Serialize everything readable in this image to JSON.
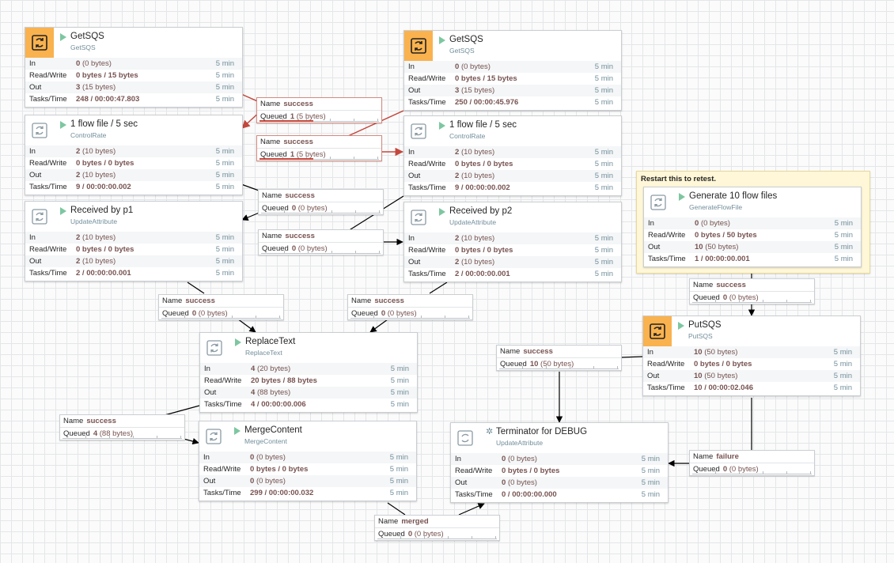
{
  "colors": {
    "active_connection": "#c4473c",
    "connection": "#000000",
    "aws_icon_bg": "#f9b24e",
    "running": "#7dc7a0"
  },
  "labels": {
    "in": "In",
    "rw": "Read/Write",
    "out": "Out",
    "tasks": "Tasks/Time",
    "name": "Name",
    "queued": "Queued",
    "window": "5 min"
  },
  "note": {
    "text": "Restart this to retest."
  },
  "processors": {
    "getsqs1": {
      "icon": "aws-sqs-icon",
      "title": "GetSQS",
      "type": "GetSQS",
      "running": true,
      "in_v": "0",
      "in_s": "(0 bytes)",
      "rw": "0 bytes / 15 bytes",
      "out_v": "3",
      "out_s": "(15 bytes)",
      "tasks": "248 / 00:00:47.803"
    },
    "getsqs2": {
      "icon": "aws-sqs-icon",
      "title": "GetSQS",
      "type": "GetSQS",
      "running": true,
      "in_v": "0",
      "in_s": "(0 bytes)",
      "rw": "0 bytes / 15 bytes",
      "out_v": "3",
      "out_s": "(15 bytes)",
      "tasks": "250 / 00:00:45.976"
    },
    "rate1": {
      "icon": "processor-icon",
      "title": "1 flow file / 5 sec",
      "type": "ControlRate",
      "running": true,
      "in_v": "2",
      "in_s": "(10 bytes)",
      "rw": "0 bytes / 0 bytes",
      "out_v": "2",
      "out_s": "(10 bytes)",
      "tasks": "9 / 00:00:00.002"
    },
    "rate2": {
      "icon": "processor-icon",
      "title": "1 flow file / 5 sec",
      "type": "ControlRate",
      "running": true,
      "in_v": "2",
      "in_s": "(10 bytes)",
      "rw": "0 bytes / 0 bytes",
      "out_v": "2",
      "out_s": "(10 bytes)",
      "tasks": "9 / 00:00:00.002"
    },
    "recv1": {
      "icon": "processor-icon",
      "title": "Received by p1",
      "type": "UpdateAttribute",
      "running": true,
      "in_v": "2",
      "in_s": "(10 bytes)",
      "rw": "0 bytes / 0 bytes",
      "out_v": "2",
      "out_s": "(10 bytes)",
      "tasks": "2 / 00:00:00.001"
    },
    "recv2": {
      "icon": "processor-icon",
      "title": "Received by p2",
      "type": "UpdateAttribute",
      "running": true,
      "in_v": "2",
      "in_s": "(10 bytes)",
      "rw": "0 bytes / 0 bytes",
      "out_v": "2",
      "out_s": "(10 bytes)",
      "tasks": "2 / 00:00:00.001"
    },
    "generate": {
      "icon": "processor-icon",
      "title": "Generate 10 flow files",
      "type": "GenerateFlowFile",
      "running": true,
      "in_v": "0",
      "in_s": "(0 bytes)",
      "rw": "0 bytes / 50 bytes",
      "out_v": "10",
      "out_s": "(50 bytes)",
      "tasks": "1 / 00:00:00.001"
    },
    "putsqs": {
      "icon": "aws-sqs-icon",
      "title": "PutSQS",
      "type": "PutSQS",
      "running": true,
      "in_v": "10",
      "in_s": "(50 bytes)",
      "rw": "0 bytes / 0 bytes",
      "out_v": "10",
      "out_s": "(50 bytes)",
      "tasks": "10 / 00:00:02.046"
    },
    "replace": {
      "icon": "processor-icon",
      "title": "ReplaceText",
      "type": "ReplaceText",
      "running": true,
      "in_v": "4",
      "in_s": "(20 bytes)",
      "rw": "20 bytes / 88 bytes",
      "out_v": "4",
      "out_s": "(88 bytes)",
      "tasks": "4 / 00:00:00.006"
    },
    "merge": {
      "icon": "processor-icon",
      "title": "MergeContent",
      "type": "MergeContent",
      "running": true,
      "in_v": "0",
      "in_s": "(0 bytes)",
      "rw": "0 bytes / 0 bytes",
      "out_v": "0",
      "out_s": "(0 bytes)",
      "tasks": "299 / 00:00:00.032"
    },
    "terminator": {
      "icon": "running-person-icon",
      "title": "Terminator for DEBUG",
      "type": "UpdateAttribute",
      "running": false,
      "in_v": "0",
      "in_s": "(0 bytes)",
      "rw": "0 bytes / 0 bytes",
      "out_v": "0",
      "out_s": "(0 bytes)",
      "tasks": "0 / 00:00:00.000"
    }
  },
  "connections": {
    "c1": {
      "name": "success",
      "queued_v": "1",
      "queued_s": "(5 bytes)",
      "active": true
    },
    "c2": {
      "name": "success",
      "queued_v": "1",
      "queued_s": "(5 bytes)",
      "active": true
    },
    "c3": {
      "name": "success",
      "queued_v": "0",
      "queued_s": "(0 bytes)",
      "active": false
    },
    "c4": {
      "name": "success",
      "queued_v": "0",
      "queued_s": "(0 bytes)",
      "active": false
    },
    "c5": {
      "name": "success",
      "queued_v": "0",
      "queued_s": "(0 bytes)",
      "active": false
    },
    "c6": {
      "name": "success",
      "queued_v": "0",
      "queued_s": "(0 bytes)",
      "active": false
    },
    "c7": {
      "name": "success",
      "queued_v": "0",
      "queued_s": "(0 bytes)",
      "active": false
    },
    "c8": {
      "name": "success",
      "queued_v": "10",
      "queued_s": "(50 bytes)",
      "active": false
    },
    "c9": {
      "name": "success",
      "queued_v": "4",
      "queued_s": "(88 bytes)",
      "active": false
    },
    "c10": {
      "name": "failure",
      "queued_v": "0",
      "queued_s": "(0 bytes)",
      "active": false
    },
    "c11": {
      "name": "merged",
      "queued_v": "0",
      "queued_s": "(0 bytes)",
      "active": false
    }
  }
}
